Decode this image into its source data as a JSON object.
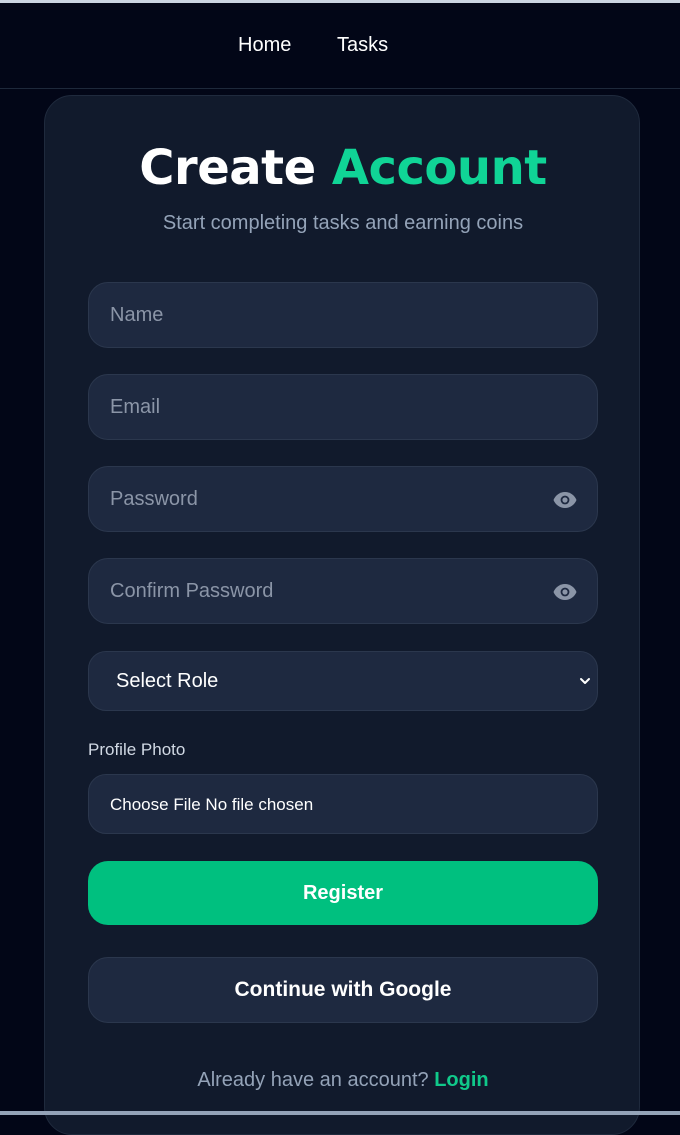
{
  "nav": {
    "home_label": "Home",
    "tasks_label": "Tasks"
  },
  "header": {
    "title_part1": "Create",
    "title_part2": "Account",
    "subtitle": "Start completing tasks and earning coins"
  },
  "form": {
    "name_placeholder": "Name",
    "email_placeholder": "Email",
    "password_placeholder": "Password",
    "confirm_password_placeholder": "Confirm Password",
    "role_selected": "Select Role",
    "photo_label": "Profile Photo",
    "file_input_text": "Choose File No file chosen",
    "register_label": "Register",
    "google_label": "Continue with Google"
  },
  "footer": {
    "prompt": "Already have an account?",
    "login_label": "Login"
  },
  "icons": {
    "password_toggle": "eye-icon",
    "select_arrow": "chevron-down-icon"
  },
  "colors": {
    "background": "#020617",
    "card": "#111a2c",
    "accent": "#10d496",
    "button_primary": "#00c07f",
    "field": "#1e2940"
  }
}
